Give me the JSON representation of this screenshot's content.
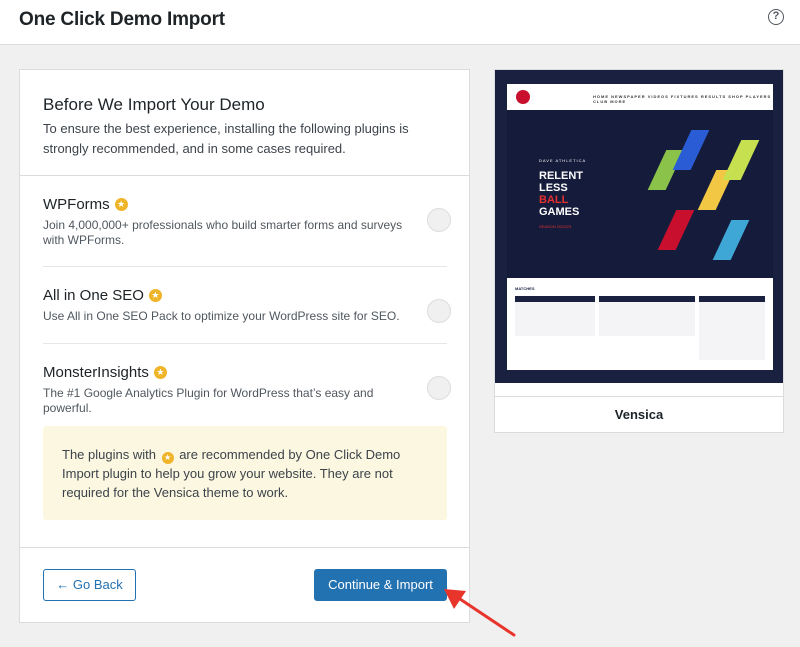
{
  "header": {
    "title": "One Click Demo Import",
    "help_icon": "help-circle-icon"
  },
  "panel": {
    "title": "Before We Import Your Demo",
    "description": "To ensure the best experience, installing the following plugins is strongly recommended, and in some cases required.",
    "plugins": [
      {
        "name": "WPForms",
        "description": "Join 4,000,000+ professionals who build smarter forms and surveys with WPForms.",
        "recommended": true,
        "checked": false
      },
      {
        "name": "All in One SEO",
        "description": "Use All in One SEO Pack to optimize your WordPress site for SEO.",
        "recommended": true,
        "checked": false
      },
      {
        "name": "MonsterInsights",
        "description": "The #1 Google Analytics Plugin for WordPress that’s easy and powerful.",
        "recommended": true,
        "checked": false
      }
    ],
    "notice": {
      "before": "The plugins with",
      "after": "are recommended by One Click Demo Import plugin to help you grow your website. They are not required for the Vensica theme to work."
    },
    "back_label": "← Go Back",
    "continue_label": "Continue & Import"
  },
  "theme": {
    "name": "Vensica",
    "preview": {
      "nav": "HOME  NEWSPAPER  VIDEOS  FIXTURES  RESULTS  SHOP  PLAYERS  CLUB  MORE",
      "hero_small": "DAVE ATHLETICA",
      "hero_lines": [
        "RELENT",
        "LESS",
        "BALL",
        "GAMES"
      ],
      "hero_season": "SEASON 2022/23",
      "matches_label": "MATCHES"
    }
  },
  "colors": {
    "accent": "#2271b1",
    "star": "#f0b429",
    "notice_bg": "#fcf7e1",
    "arrow": "#e8342a"
  }
}
